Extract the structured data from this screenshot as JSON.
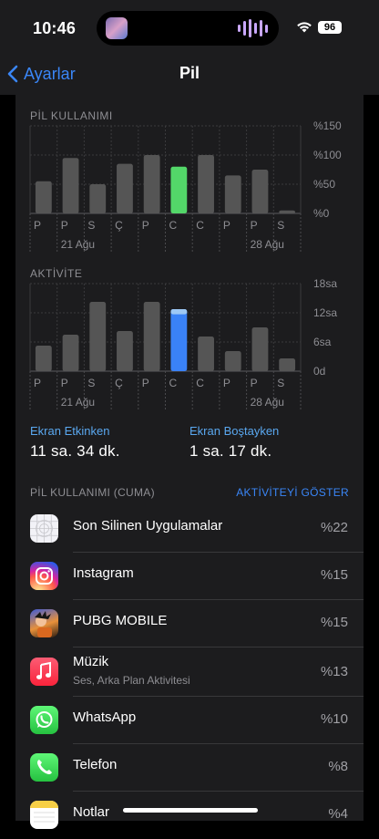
{
  "status": {
    "time": "10:46",
    "battery": "96"
  },
  "nav": {
    "back_label": "Ayarlar",
    "title": "Pil"
  },
  "usage_section": {
    "title": "PİL KULLANIMI"
  },
  "activity_section": {
    "title": "AKTİVİTE"
  },
  "chart_data": [
    {
      "type": "bar",
      "title": "PİL KULLANIMI",
      "categories": [
        "P",
        "P",
        "S",
        "Ç",
        "P",
        "C",
        "C",
        "P",
        "P",
        "S"
      ],
      "values": [
        55,
        95,
        50,
        85,
        100,
        80,
        100,
        65,
        75,
        5
      ],
      "highlight_index": 5,
      "highlight_color": "#53d769",
      "bar_color": "#555555",
      "y_ticks": [
        "%150",
        "%100",
        "%50",
        "%0"
      ],
      "ylim": [
        0,
        150
      ],
      "date_labels": [
        "21 Ağu",
        "28 Ağu"
      ]
    },
    {
      "type": "bar",
      "title": "AKTİVİTE",
      "categories": [
        "P",
        "P",
        "S",
        "Ç",
        "P",
        "C",
        "C",
        "P",
        "P",
        "S"
      ],
      "values": [
        7,
        10,
        19,
        11,
        19,
        17,
        9.5,
        5.5,
        12,
        3.5
      ],
      "screen_off_top": [
        0,
        0,
        0,
        0,
        0,
        1.4,
        0,
        0,
        0,
        0
      ],
      "highlight_index": 5,
      "highlight_color": "#3a82f7",
      "highlight_light_color": "#9dc8f5",
      "bar_color": "#555555",
      "y_ticks": [
        "18sa",
        "12sa",
        "6sa",
        "0d"
      ],
      "ylim": [
        0,
        24
      ],
      "date_labels": [
        "21 Ağu",
        "28 Ağu"
      ]
    }
  ],
  "screen_on": {
    "label": "Ekran Etkinken",
    "value": "11 sa. 34 dk."
  },
  "screen_off": {
    "label": "Ekran Boştayken",
    "value": "1 sa. 17 dk."
  },
  "list": {
    "header": "PİL KULLANIMI (CUMA)",
    "action": "AKTİVİTEYİ GÖSTER",
    "items": [
      {
        "name": "Son Silinen Uygulamalar",
        "sub": "",
        "pct": "%22",
        "icon": "deleted-apps-icon"
      },
      {
        "name": "Instagram",
        "sub": "",
        "pct": "%15",
        "icon": "instagram-icon"
      },
      {
        "name": "PUBG MOBILE",
        "sub": "",
        "pct": "%15",
        "icon": "pubg-icon"
      },
      {
        "name": "Müzik",
        "sub": "Ses, Arka Plan Aktivitesi",
        "pct": "%13",
        "icon": "music-icon"
      },
      {
        "name": "WhatsApp",
        "sub": "",
        "pct": "%10",
        "icon": "whatsapp-icon"
      },
      {
        "name": "Telefon",
        "sub": "",
        "pct": "%8",
        "icon": "phone-icon"
      },
      {
        "name": "Notlar",
        "sub": "",
        "pct": "%4",
        "icon": "notes-icon"
      }
    ]
  }
}
